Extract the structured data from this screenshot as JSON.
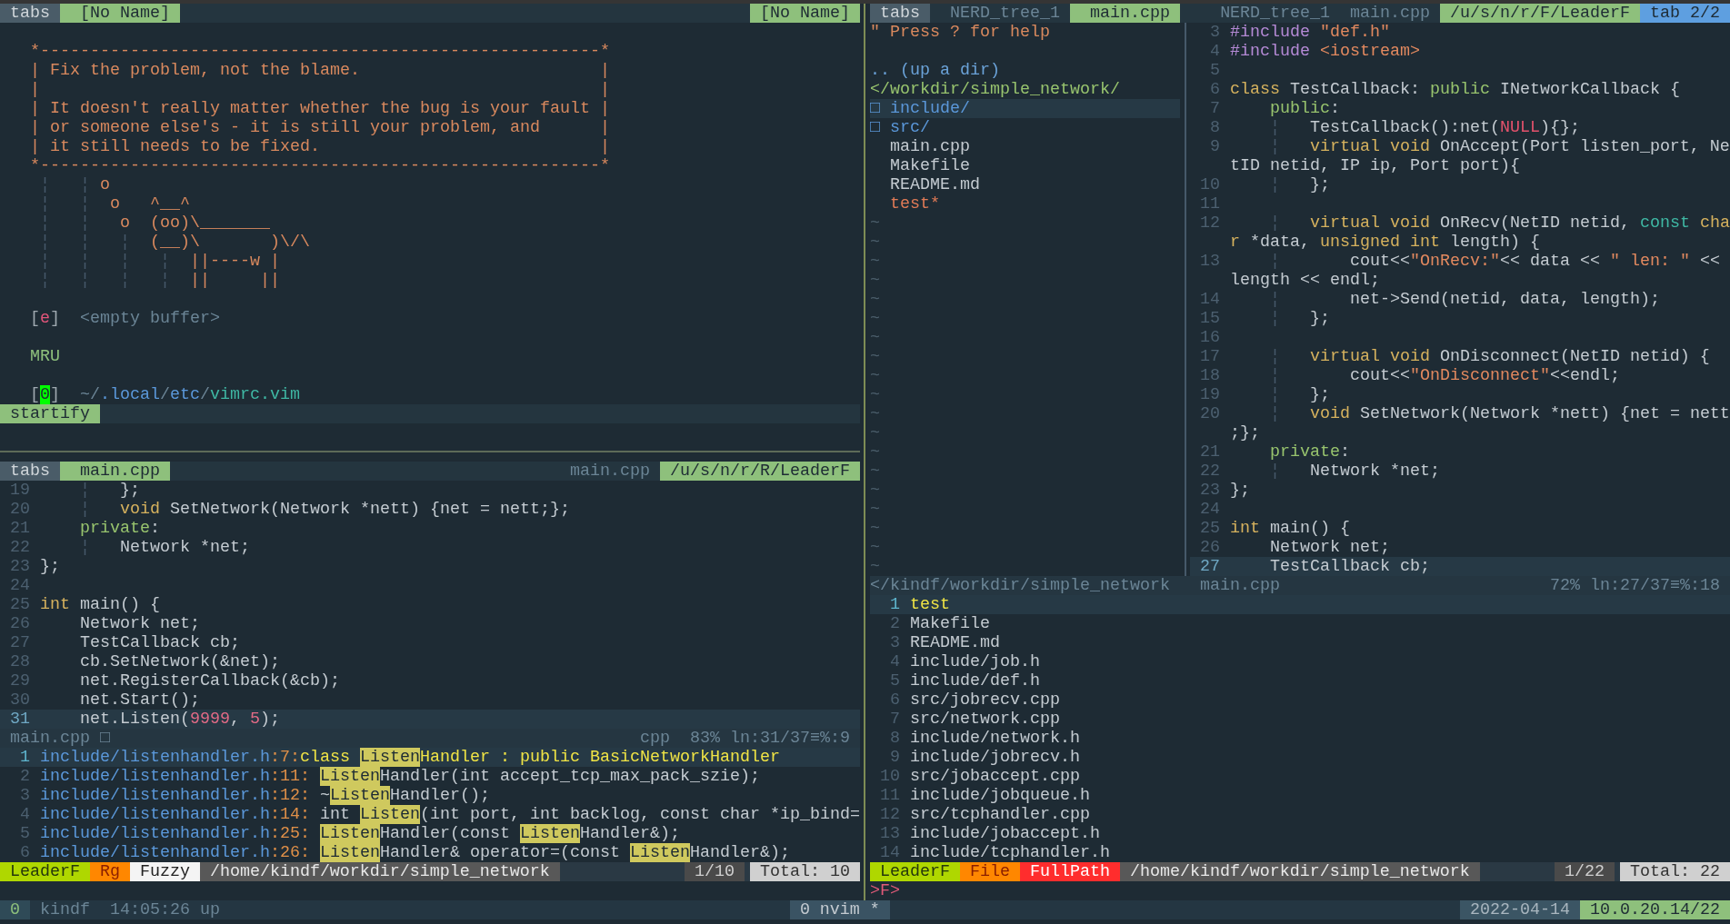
{
  "top_left_pane": {
    "tabline": {
      "label": "tabs",
      "tabs": [
        {
          "label": "[No Name]",
          "selected": true
        }
      ],
      "right": [
        {
          "text": "[No Name]",
          "kind": "active"
        }
      ]
    },
    "quote_box": [
      "*--------------------------------------------------------*",
      "| Fix the problem, not the blame.                        |",
      "|                                                        |",
      "| It doesn't really matter whether the bug is your fault |",
      "| or someone else's - it is still your problem, and      |",
      "| it still needs to be fixed.                            |",
      "*--------------------------------------------------------*"
    ],
    "cow": [
      [
        {
          "text": " ¦   ¦ ",
          "kind": "guide"
        },
        {
          "text": "o",
          "kind": "art"
        }
      ],
      [
        {
          "text": " ¦   ¦  ",
          "kind": "guide"
        },
        {
          "text": "o   ^__^",
          "kind": "art"
        }
      ],
      [
        {
          "text": " ¦   ¦   ",
          "kind": "guide"
        },
        {
          "text": "o  (oo)\\_______",
          "kind": "art"
        }
      ],
      [
        {
          "text": " ¦   ¦   ¦  ",
          "kind": "guide"
        },
        {
          "text": "(__)\\       )\\/\\",
          "kind": "art"
        }
      ],
      [
        {
          "text": " ¦   ¦   ¦   ¦  ",
          "kind": "guide"
        },
        {
          "text": "||----w |",
          "kind": "art"
        }
      ],
      [
        {
          "text": " ¦   ¦   ¦   ¦  ",
          "kind": "guide"
        },
        {
          "text": "||     ||",
          "kind": "art"
        }
      ]
    ],
    "buffers": [
      {
        "key": [
          {
            "text": "[",
            "kind": "bracket"
          },
          {
            "text": "e",
            "kind": "key"
          },
          {
            "text": "]",
            "kind": "bracket"
          }
        ],
        "label": "<empty buffer>"
      }
    ],
    "mru_title": "MRU",
    "mru": [
      {
        "key": [
          {
            "text": "[",
            "kind": "bracket"
          },
          {
            "text": "0",
            "kind": "cursor"
          },
          {
            "text": "]",
            "kind": "bracket"
          }
        ],
        "path": [
          {
            "text": "~/",
            "kind": "dim"
          },
          {
            "text": ".local",
            "kind": "dir"
          },
          {
            "text": "/",
            "kind": "dim"
          },
          {
            "text": "etc",
            "kind": "dir"
          },
          {
            "text": "/",
            "kind": "dim"
          },
          {
            "text": "vimrc.vim",
            "kind": "name"
          }
        ]
      }
    ],
    "status": {
      "mode": "startify"
    }
  },
  "bottom_left_pane": {
    "tabline": {
      "label": "tabs",
      "tabs": [
        {
          "label": "main.cpp",
          "selected": true
        }
      ],
      "right": [
        {
          "text": "main.cpp",
          "kind": "inactive"
        },
        {
          "text": "/u/s/n/r/R/LeaderF",
          "kind": "active"
        }
      ]
    },
    "code": {
      "lines": [
        {
          "number": "19",
          "segments": [
            {
              "text": "    ¦   ",
              "kind": "guide"
            },
            {
              "text": "};",
              "kind": "plain"
            }
          ],
          "current": false
        },
        {
          "number": "20",
          "segments": [
            {
              "text": "    ¦   ",
              "kind": "guide"
            },
            {
              "text": "void",
              "kind": "keyword"
            },
            {
              "text": " SetNetwork(Network *nett) {net = nett;};",
              "kind": "plain"
            }
          ],
          "current": false
        },
        {
          "number": "21",
          "segments": [
            {
              "text": "    private",
              "kind": "access"
            },
            {
              "text": ":",
              "kind": "plain"
            }
          ],
          "current": false
        },
        {
          "number": "22",
          "segments": [
            {
              "text": "    ¦   ",
              "kind": "guide"
            },
            {
              "text": "Network *net;",
              "kind": "plain"
            }
          ],
          "current": false
        },
        {
          "number": "23",
          "segments": [
            {
              "text": "};",
              "kind": "plain"
            }
          ],
          "current": false
        },
        {
          "number": "24",
          "current": false
        },
        {
          "number": "25",
          "segments": [
            {
              "text": "int",
              "kind": "keyword"
            },
            {
              "text": " main() {",
              "kind": "plain"
            }
          ],
          "current": false
        },
        {
          "number": "26",
          "segments": [
            {
              "text": "    Network net;",
              "kind": "plain"
            }
          ],
          "current": false
        },
        {
          "number": "27",
          "segments": [
            {
              "text": "    TestCallback cb;",
              "kind": "plain"
            }
          ],
          "current": false
        },
        {
          "number": "28",
          "segments": [
            {
              "text": "    cb.SetNetwork(&net);",
              "kind": "plain"
            }
          ],
          "current": false
        },
        {
          "number": "29",
          "segments": [
            {
              "text": "    net.RegisterCallback(&cb);",
              "kind": "plain"
            }
          ],
          "current": false
        },
        {
          "number": "30",
          "segments": [
            {
              "text": "    net.Start();",
              "kind": "plain"
            }
          ],
          "current": false
        },
        {
          "number": "31",
          "segments": [
            {
              "text": "    net.Listen(",
              "kind": "plain"
            },
            {
              "text": "9999",
              "kind": "number"
            },
            {
              "text": ", ",
              "kind": "plain"
            },
            {
              "text": "5",
              "kind": "number"
            },
            {
              "text": ");",
              "kind": "plain"
            }
          ],
          "current": true
        }
      ]
    },
    "status": {
      "file": "main.cpp",
      "flag": "□",
      "filetype": "cpp",
      "percent": "83%",
      "position": "ln:31/37≡%:9"
    },
    "results": [
      {
        "number": "1",
        "segments": [
          {
            "text": "include/listenhandler.h",
            "kind": "path"
          },
          {
            "text": ":7:",
            "kind": "lineref"
          },
          {
            "text": "class ",
            "kind": "plain"
          },
          {
            "text": "Listen",
            "kind": "match"
          },
          {
            "text": "Handler : public BasicNetworkHandler",
            "kind": "plain"
          }
        ],
        "selected": true
      },
      {
        "number": "2",
        "segments": [
          {
            "text": "include/listenhandler.h",
            "kind": "path"
          },
          {
            "text": ":11: ",
            "kind": "lineref"
          },
          {
            "text": "Listen",
            "kind": "match"
          },
          {
            "text": "Handler(int accept_tcp_max_pack_szie);",
            "kind": "plain"
          }
        ],
        "selected": false
      },
      {
        "number": "3",
        "segments": [
          {
            "text": "include/listenhandler.h",
            "kind": "path"
          },
          {
            "text": ":12:",
            "kind": "lineref"
          },
          {
            "text": " ~",
            "kind": "plain"
          },
          {
            "text": "Listen",
            "kind": "match"
          },
          {
            "text": "Handler();",
            "kind": "plain"
          }
        ],
        "selected": false
      },
      {
        "number": "4",
        "segments": [
          {
            "text": "include/listenhandler.h",
            "kind": "path"
          },
          {
            "text": ":14:",
            "kind": "lineref"
          },
          {
            "text": " int ",
            "kind": "plain"
          },
          {
            "text": "Listen",
            "kind": "match"
          },
          {
            "text": "(int port, int backlog, const char *ip_bind=",
            "kind": "plain"
          }
        ],
        "selected": false
      },
      {
        "number": "5",
        "segments": [
          {
            "text": "include/listenhandler.h",
            "kind": "path"
          },
          {
            "text": ":25: ",
            "kind": "lineref"
          },
          {
            "text": "Listen",
            "kind": "match"
          },
          {
            "text": "Handler(const ",
            "kind": "plain"
          },
          {
            "text": "Listen",
            "kind": "match"
          },
          {
            "text": "Handler&);",
            "kind": "plain"
          }
        ],
        "selected": false
      },
      {
        "number": "6",
        "segments": [
          {
            "text": "include/listenhandler.h",
            "kind": "path"
          },
          {
            "text": ":26: ",
            "kind": "lineref"
          },
          {
            "text": "Listen",
            "kind": "match"
          },
          {
            "text": "Handler& operator=(const ",
            "kind": "plain"
          },
          {
            "text": "Listen",
            "kind": "match"
          },
          {
            "text": "Handler&);",
            "kind": "plain"
          }
        ],
        "selected": false
      }
    ],
    "leaderf_status": {
      "left": [
        {
          "text": "LeaderF",
          "kind": "plugin"
        },
        {
          "text": "Rg",
          "kind": "category"
        },
        {
          "text": "Fuzzy",
          "kind": "fuzzy"
        },
        {
          "text": "/home/kindf/workdir/simple_network",
          "kind": "cwd"
        }
      ],
      "right": [
        {
          "text": "1/10",
          "kind": "position"
        },
        {
          "text": "Total: 10",
          "kind": "total"
        }
      ]
    }
  },
  "right_pane": {
    "tabline": {
      "label": "tabs",
      "tabs": [
        {
          "label": "NERD_tree_1",
          "selected": false
        },
        {
          "label": "main.cpp",
          "selected": true
        }
      ],
      "right": [
        {
          "text": "NERD_tree_1",
          "kind": "inactive"
        },
        {
          "text": "main.cpp",
          "kind": "inactive"
        },
        {
          "text": "/u/s/n/r/F/LeaderF",
          "kind": "active"
        },
        {
          "text": "tab 2/2",
          "kind": "tabcount"
        }
      ]
    },
    "tree": {
      "help": "\" Press ? for help",
      "up": ".. (up a dir)",
      "root": "</workdir/simple_network/",
      "entries": [
        {
          "icon": "□",
          "name": "include/",
          "kind": "dir",
          "selected": true
        },
        {
          "icon": "□",
          "name": "src/",
          "kind": "dir",
          "selected": false
        },
        {
          "name": "main.cpp",
          "kind": "file",
          "selected": false
        },
        {
          "name": "Makefile",
          "kind": "file",
          "selected": false
        },
        {
          "name": "README.md",
          "kind": "file",
          "selected": false
        },
        {
          "name": "test*",
          "kind": "exec",
          "selected": false
        }
      ],
      "filler": [
        "~",
        "~",
        "~",
        "~",
        "~",
        "~",
        "~",
        "~",
        "~",
        "~",
        "~",
        "~",
        "~",
        "~",
        "~",
        "~",
        "~",
        "~",
        "~"
      ]
    },
    "code": {
      "lines": [
        {
          "number": "3",
          "segments": [
            {
              "text": "#include",
              "kind": "preproc"
            },
            {
              "text": " \"def.h\"",
              "kind": "string"
            }
          ],
          "current": false
        },
        {
          "number": "4",
          "segments": [
            {
              "text": "#include",
              "kind": "preproc"
            },
            {
              "text": " <iostream>",
              "kind": "string"
            }
          ],
          "current": false
        },
        {
          "number": "5",
          "current": false
        },
        {
          "number": "6",
          "segments": [
            {
              "text": "class",
              "kind": "keyword"
            },
            {
              "text": " TestCallback: ",
              "kind": "plain"
            },
            {
              "text": "public",
              "kind": "access"
            },
            {
              "text": " INetworkCallback {",
              "kind": "plain"
            }
          ],
          "current": false
        },
        {
          "number": "7",
          "segments": [
            {
              "text": "    public",
              "kind": "access"
            },
            {
              "text": ":",
              "kind": "plain"
            }
          ],
          "current": false
        },
        {
          "number": "8",
          "segments": [
            {
              "text": "    ¦   ",
              "kind": "guide"
            },
            {
              "text": "TestCallback():net(",
              "kind": "plain"
            },
            {
              "text": "NULL",
              "kind": "constant"
            },
            {
              "text": "){};",
              "kind": "plain"
            }
          ],
          "current": false
        },
        {
          "number": "9",
          "segments": [
            {
              "text": "    ¦   ",
              "kind": "guide"
            },
            {
              "text": "virtual void",
              "kind": "keyword"
            },
            {
              "text": " OnAccept(Port listen_port, Ne",
              "kind": "plain"
            }
          ],
          "current": false
        },
        {
          "segments": [
            {
              "text": "tID netid, IP ip, Port port){",
              "kind": "plain"
            }
          ],
          "current": false
        },
        {
          "number": "10",
          "segments": [
            {
              "text": "    ¦   ",
              "kind": "guide"
            },
            {
              "text": "};",
              "kind": "plain"
            }
          ],
          "current": false
        },
        {
          "number": "11",
          "current": false
        },
        {
          "number": "12",
          "segments": [
            {
              "text": "    ¦   ",
              "kind": "guide"
            },
            {
              "text": "virtual void",
              "kind": "keyword"
            },
            {
              "text": " OnRecv(NetID netid, ",
              "kind": "plain"
            },
            {
              "text": "const",
              "kind": "qualifier"
            },
            {
              "text": " cha",
              "kind": "keyword"
            }
          ],
          "current": false
        },
        {
          "segments": [
            {
              "text": "r",
              "kind": "keyword"
            },
            {
              "text": " *data, ",
              "kind": "plain"
            },
            {
              "text": "unsigned int",
              "kind": "keyword"
            },
            {
              "text": " length) {",
              "kind": "plain"
            }
          ],
          "current": false
        },
        {
          "number": "13",
          "segments": [
            {
              "text": "    ¦       ",
              "kind": "guide"
            },
            {
              "text": "cout<<",
              "kind": "plain"
            },
            {
              "text": "\"OnRecv:\"",
              "kind": "string"
            },
            {
              "text": "<< data << ",
              "kind": "plain"
            },
            {
              "text": "\" len: \"",
              "kind": "string"
            },
            {
              "text": " <<",
              "kind": "plain"
            }
          ],
          "current": false
        },
        {
          "segments": [
            {
              "text": "length << endl;",
              "kind": "plain"
            }
          ],
          "current": false
        },
        {
          "number": "14",
          "segments": [
            {
              "text": "    ¦       ",
              "kind": "guide"
            },
            {
              "text": "net->Send(netid, data, length);",
              "kind": "plain"
            }
          ],
          "current": false
        },
        {
          "number": "15",
          "segments": [
            {
              "text": "    ¦   ",
              "kind": "guide"
            },
            {
              "text": "};",
              "kind": "plain"
            }
          ],
          "current": false
        },
        {
          "number": "16",
          "current": false
        },
        {
          "number": "17",
          "segments": [
            {
              "text": "    ¦   ",
              "kind": "guide"
            },
            {
              "text": "virtual void",
              "kind": "keyword"
            },
            {
              "text": " OnDisconnect(NetID netid) {",
              "kind": "plain"
            }
          ],
          "current": false
        },
        {
          "number": "18",
          "segments": [
            {
              "text": "    ¦       ",
              "kind": "guide"
            },
            {
              "text": "cout<<",
              "kind": "plain"
            },
            {
              "text": "\"OnDisconnect\"",
              "kind": "string"
            },
            {
              "text": "<<endl;",
              "kind": "plain"
            }
          ],
          "current": false
        },
        {
          "number": "19",
          "segments": [
            {
              "text": "    ¦   ",
              "kind": "guide"
            },
            {
              "text": "};",
              "kind": "plain"
            }
          ],
          "current": false
        },
        {
          "number": "20",
          "segments": [
            {
              "text": "    ¦   ",
              "kind": "guide"
            },
            {
              "text": "void",
              "kind": "keyword"
            },
            {
              "text": " SetNetwork(Network *nett) {net = nett",
              "kind": "plain"
            }
          ],
          "current": false
        },
        {
          "segments": [
            {
              "text": ";};",
              "kind": "plain"
            }
          ],
          "current": false
        },
        {
          "number": "21",
          "segments": [
            {
              "text": "    private",
              "kind": "access"
            },
            {
              "text": ":",
              "kind": "plain"
            }
          ],
          "current": false
        },
        {
          "number": "22",
          "segments": [
            {
              "text": "    ¦   ",
              "kind": "guide"
            },
            {
              "text": "Network *net;",
              "kind": "plain"
            }
          ],
          "current": false
        },
        {
          "number": "23",
          "segments": [
            {
              "text": "};",
              "kind": "plain"
            }
          ],
          "current": false
        },
        {
          "number": "24",
          "current": false
        },
        {
          "number": "25",
          "segments": [
            {
              "text": "int",
              "kind": "keyword"
            },
            {
              "text": " main() {",
              "kind": "plain"
            }
          ],
          "current": false
        },
        {
          "number": "26",
          "segments": [
            {
              "text": "    Network net;",
              "kind": "plain"
            }
          ],
          "current": false
        },
        {
          "number": "27",
          "segments": [
            {
              "text": "    TestCallback cb;",
              "kind": "plain"
            }
          ],
          "current": true
        }
      ]
    },
    "status": {
      "tree": "</kindf/workdir/simple_network",
      "file": "main.cpp",
      "percent": "72%",
      "position": "ln:27/37≡%:18"
    },
    "results": [
      {
        "number": "1",
        "text": "test",
        "selected": true
      },
      {
        "number": "2",
        "text": "Makefile",
        "selected": false
      },
      {
        "number": "3",
        "text": "README.md",
        "selected": false
      },
      {
        "number": "4",
        "text": "include/job.h",
        "selected": false
      },
      {
        "number": "5",
        "text": "include/def.h",
        "selected": false
      },
      {
        "number": "6",
        "text": "src/jobrecv.cpp",
        "selected": false
      },
      {
        "number": "7",
        "text": "src/network.cpp",
        "selected": false
      },
      {
        "number": "8",
        "text": "include/network.h",
        "selected": false
      },
      {
        "number": "9",
        "text": "include/jobrecv.h",
        "selected": false
      },
      {
        "number": "10",
        "text": "src/jobaccept.cpp",
        "selected": false
      },
      {
        "number": "11",
        "text": "include/jobqueue.h",
        "selected": false
      },
      {
        "number": "12",
        "text": "src/tcphandler.cpp",
        "selected": false
      },
      {
        "number": "13",
        "text": "include/jobaccept.h",
        "selected": false
      },
      {
        "number": "14",
        "text": "include/tcphandler.h",
        "selected": false
      }
    ],
    "leaderf_status": {
      "left": [
        {
          "text": "LeaderF",
          "kind": "plugin"
        },
        {
          "text": "File",
          "kind": "category"
        },
        {
          "text": "FullPath",
          "kind": "fullpath"
        },
        {
          "text": "/home/kindf/workdir/simple_network",
          "kind": "cwd"
        }
      ],
      "right": [
        {
          "text": "1/22",
          "kind": "position"
        },
        {
          "text": "Total: 22",
          "kind": "total"
        }
      ]
    },
    "prompt": ">F>"
  },
  "tmux_status": {
    "session": "0",
    "host": "kindf",
    "uptime": "14:05:26 up",
    "window": "0 nvim *",
    "date": "2022-04-14",
    "address": "10.0.20.14/22"
  }
}
